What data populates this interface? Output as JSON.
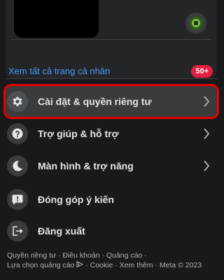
{
  "profile": {
    "see_all_label": "Xem tất cả trang cá nhân",
    "badge_count": "50+"
  },
  "menu": {
    "items": [
      {
        "label": "Cài đặt & quyền riêng tư",
        "icon": "gear-icon",
        "has_chevron": true,
        "highlighted": true
      },
      {
        "label": "Trợ giúp & hỗ trợ",
        "icon": "question-icon",
        "has_chevron": true
      },
      {
        "label": "Màn hình & trợ năng",
        "icon": "moon-icon",
        "has_chevron": true
      },
      {
        "label": "Đóng góp ý kiến",
        "icon": "feedback-icon",
        "has_chevron": false
      },
      {
        "label": "Đăng xuất",
        "icon": "logout-icon",
        "has_chevron": false
      }
    ]
  },
  "footer": {
    "privacy": "Quyền riêng tư",
    "terms": "Điều khoản",
    "ads": "Quảng cáo",
    "ad_choices": "Lựa chọn quảng cáo",
    "cookie": "Cookie",
    "more": "Xem thêm",
    "copyright": "Meta © 2023",
    "separator": " · "
  },
  "colors": {
    "background": "#18191a",
    "card": "#242526",
    "link": "#4599ff",
    "badge": "#e41e3f",
    "highlight_outline": "#e60000"
  }
}
